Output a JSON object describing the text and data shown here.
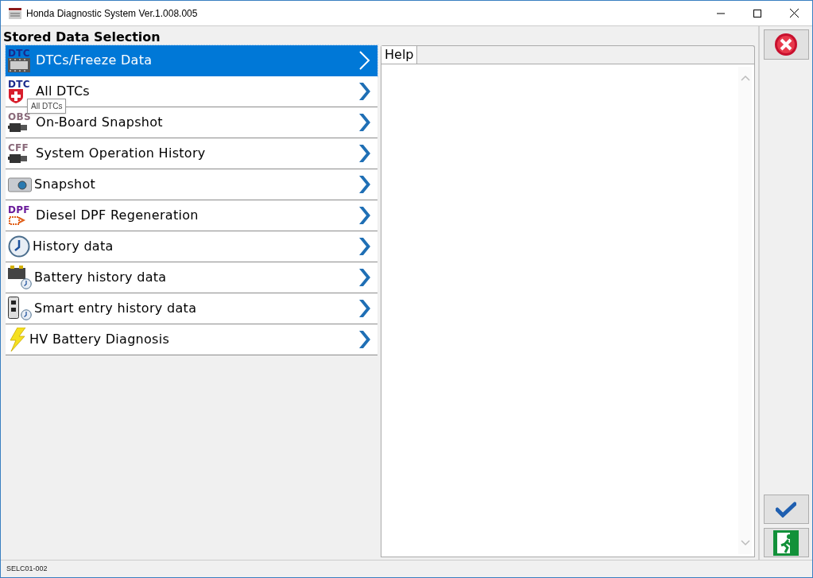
{
  "window": {
    "title": "Honda Diagnostic System Ver.1.008.005"
  },
  "heading": "Stored Data Selection",
  "items": [
    {
      "label": "DTCs/Freeze Data",
      "kind": "film",
      "icon_text": "DTC",
      "selected": true
    },
    {
      "label": "All DTCs",
      "kind": "cross",
      "icon_text": "DTC",
      "selected": false
    },
    {
      "label": "On-Board Snapshot",
      "kind": "camera",
      "icon_text": "OBS",
      "selected": false
    },
    {
      "label": "System Operation History",
      "kind": "camera",
      "icon_text": "CFF",
      "selected": false
    },
    {
      "label": "Snapshot",
      "kind": "snapshot",
      "selected": false
    },
    {
      "label": "Diesel DPF Regeneration",
      "kind": "dpf",
      "icon_text": "DPF",
      "selected": false
    },
    {
      "label": "History data",
      "kind": "clock",
      "selected": false
    },
    {
      "label": "Battery history data",
      "kind": "battery",
      "selected": false
    },
    {
      "label": "Smart entry history data",
      "kind": "smart",
      "selected": false
    },
    {
      "label": "HV Battery Diagnosis",
      "kind": "bolt",
      "selected": false
    }
  ],
  "tooltip": "All DTCs",
  "help_tab": "Help",
  "status_bar": "SELC01-002"
}
